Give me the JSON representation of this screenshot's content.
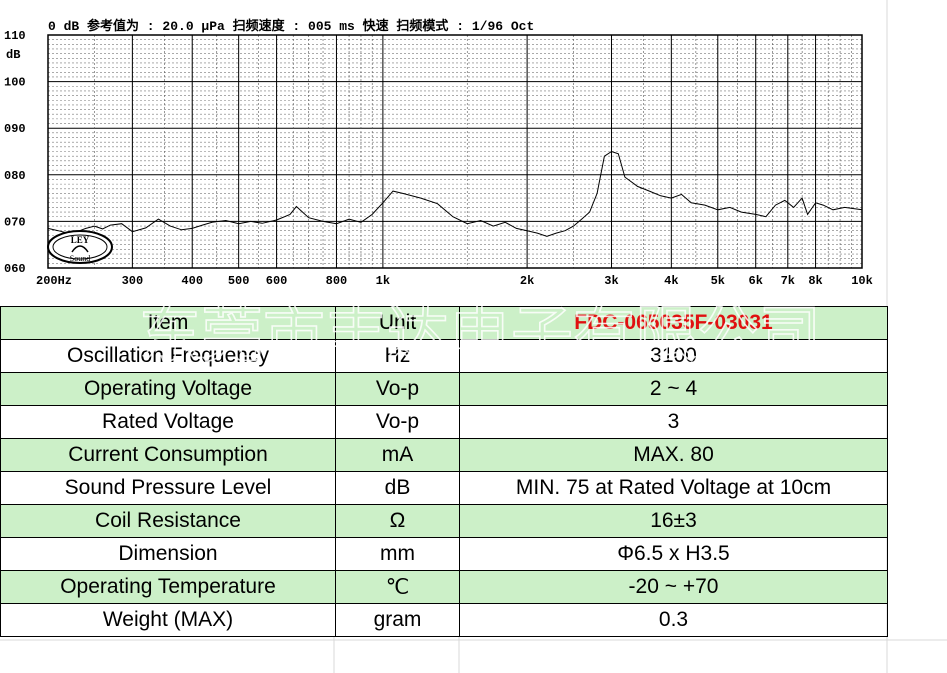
{
  "chart_data": {
    "type": "line",
    "header": "0 dB 参考值为 : 20.0 μPa    扫频速度 : 005 ms 快速   扫频模式 : 1/96  Oct",
    "y_unit": "dB",
    "y_ticks": [
      "110",
      "100",
      "090",
      "080",
      "070",
      "060"
    ],
    "ylim": [
      60,
      110
    ],
    "x_scale": "log",
    "xlim": [
      200,
      10000
    ],
    "x_ticks": [
      {
        "label": "200Hz",
        "value": 200
      },
      {
        "label": "300",
        "value": 300
      },
      {
        "label": "400",
        "value": 400
      },
      {
        "label": "500",
        "value": 500
      },
      {
        "label": "600",
        "value": 600
      },
      {
        "label": "800",
        "value": 800
      },
      {
        "label": "1k",
        "value": 1000
      },
      {
        "label": "2k",
        "value": 2000
      },
      {
        "label": "3k",
        "value": 3000
      },
      {
        "label": "4k",
        "value": 4000
      },
      {
        "label": "5k",
        "value": 5000
      },
      {
        "label": "6k",
        "value": 6000
      },
      {
        "label": "7k",
        "value": 7000
      },
      {
        "label": "8k",
        "value": 8000
      },
      {
        "label": "10k",
        "value": 10000
      }
    ],
    "grid": true,
    "series": [
      {
        "points": [
          [
            200,
            68.5
          ],
          [
            210,
            68.0
          ],
          [
            220,
            67.5
          ],
          [
            230,
            67.8
          ],
          [
            240,
            68.5
          ],
          [
            250,
            69.0
          ],
          [
            260,
            68.4
          ],
          [
            270,
            69.2
          ],
          [
            285,
            69.5
          ],
          [
            300,
            67.8
          ],
          [
            320,
            68.6
          ],
          [
            340,
            70.5
          ],
          [
            360,
            69.0
          ],
          [
            380,
            68.2
          ],
          [
            400,
            68.5
          ],
          [
            420,
            69.2
          ],
          [
            440,
            69.8
          ],
          [
            470,
            70.2
          ],
          [
            500,
            69.5
          ],
          [
            530,
            70.0
          ],
          [
            560,
            69.6
          ],
          [
            600,
            70.3
          ],
          [
            640,
            71.5
          ],
          [
            660,
            73.2
          ],
          [
            700,
            70.8
          ],
          [
            750,
            70.0
          ],
          [
            800,
            69.5
          ],
          [
            850,
            70.5
          ],
          [
            900,
            69.8
          ],
          [
            950,
            71.5
          ],
          [
            1000,
            74.0
          ],
          [
            1050,
            76.5
          ],
          [
            1100,
            76.0
          ],
          [
            1200,
            75.0
          ],
          [
            1300,
            73.8
          ],
          [
            1400,
            71.0
          ],
          [
            1500,
            69.5
          ],
          [
            1600,
            70.2
          ],
          [
            1700,
            69.0
          ],
          [
            1800,
            69.8
          ],
          [
            1900,
            68.5
          ],
          [
            2000,
            68.0
          ],
          [
            2100,
            67.5
          ],
          [
            2200,
            66.8
          ],
          [
            2300,
            67.5
          ],
          [
            2400,
            68.0
          ],
          [
            2500,
            69.0
          ],
          [
            2600,
            70.5
          ],
          [
            2700,
            72.0
          ],
          [
            2800,
            76.0
          ],
          [
            2900,
            84.0
          ],
          [
            3000,
            85.0
          ],
          [
            3100,
            84.5
          ],
          [
            3200,
            79.5
          ],
          [
            3400,
            77.5
          ],
          [
            3600,
            76.5
          ],
          [
            3800,
            75.5
          ],
          [
            4000,
            75.0
          ],
          [
            4200,
            75.8
          ],
          [
            4400,
            74.0
          ],
          [
            4700,
            73.5
          ],
          [
            5000,
            72.5
          ],
          [
            5300,
            73.0
          ],
          [
            5600,
            72.0
          ],
          [
            6000,
            71.5
          ],
          [
            6300,
            71.0
          ],
          [
            6600,
            73.5
          ],
          [
            6900,
            74.5
          ],
          [
            7200,
            73.0
          ],
          [
            7500,
            75.0
          ],
          [
            7700,
            71.5
          ],
          [
            8000,
            74.0
          ],
          [
            8300,
            73.5
          ],
          [
            8700,
            72.5
          ],
          [
            9200,
            73.0
          ],
          [
            10000,
            72.5
          ]
        ]
      }
    ]
  },
  "logo": {
    "top_text": "LEY",
    "bottom_text": "Sound"
  },
  "table": {
    "header": {
      "item": "Item",
      "unit": "Unit",
      "model": "FDC-065035F-03031"
    },
    "rows": [
      {
        "item": "Oscillation Frequency",
        "unit": "Hz",
        "value": "3100"
      },
      {
        "item": "Operating Voltage",
        "unit": "Vo-p",
        "value": "2 ~ 4"
      },
      {
        "item": "Rated Voltage",
        "unit": "Vo-p",
        "value": "3"
      },
      {
        "item": "Current Consumption",
        "unit": "mA",
        "value": "MAX. 80"
      },
      {
        "item": "Sound Pressure Level",
        "unit": "dB",
        "value": "MIN. 75 at Rated Voltage at 10cm"
      },
      {
        "item": "Coil Resistance",
        "unit": "Ω",
        "value": "16±3"
      },
      {
        "item": "Dimension",
        "unit": "mm",
        "value": "Φ6.5 x H3.5"
      },
      {
        "item": "Operating Temperature",
        "unit": "℃",
        "value": "-20 ~ +70"
      },
      {
        "item": "Weight (MAX)",
        "unit": "gram",
        "value": "0.3"
      }
    ]
  },
  "watermark": {
    "text": "东莞市丰达电子有限公司"
  },
  "colors": {
    "row_green": "#ccf0c8",
    "model_red": "#e01010",
    "chart_line": "#000000"
  }
}
